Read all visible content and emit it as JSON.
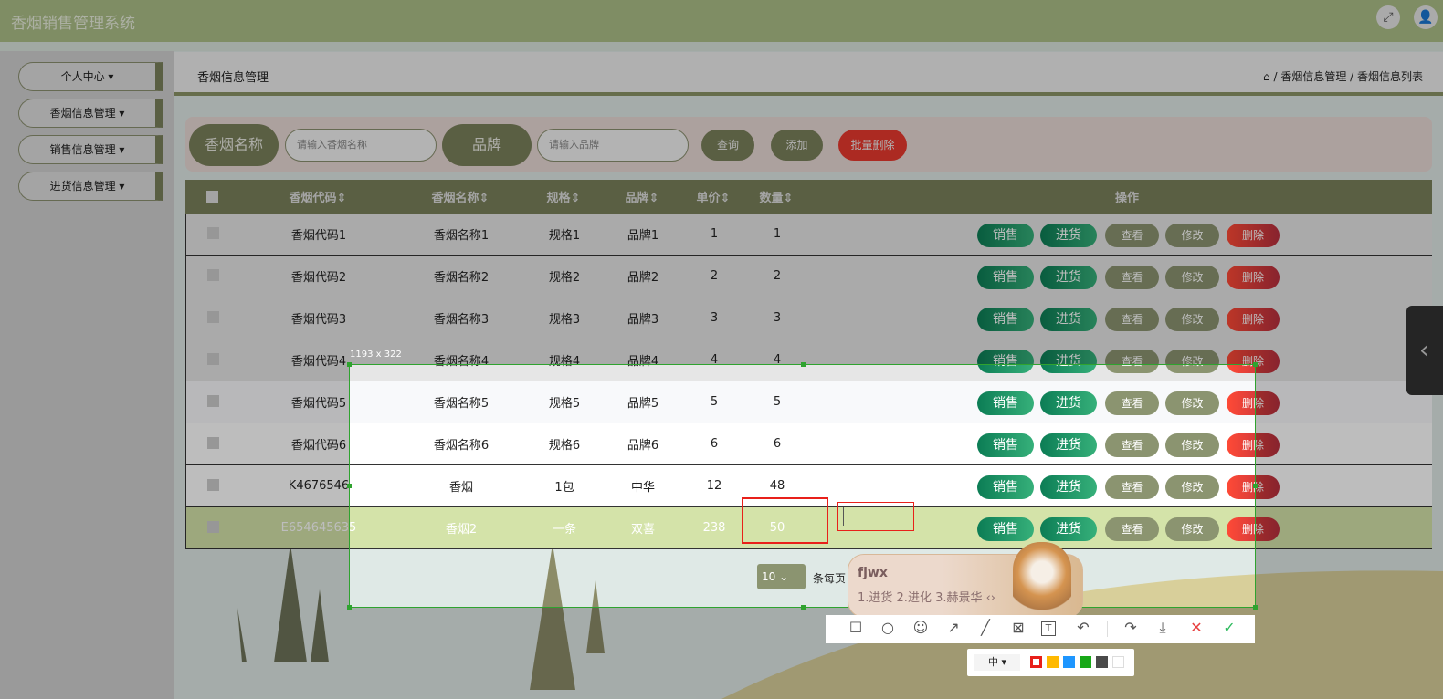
{
  "app": {
    "title": "香烟销售管理系统"
  },
  "sidebar": {
    "items": [
      {
        "label": "个人中心 ▾"
      },
      {
        "label": "香烟信息管理 ▾"
      },
      {
        "label": "销售信息管理 ▾"
      },
      {
        "label": "进货信息管理 ▾"
      }
    ]
  },
  "breadcrumb": {
    "title": "香烟信息管理",
    "path": "⌂ / 香烟信息管理 / 香烟信息列表"
  },
  "search": {
    "name_label": "香烟名称",
    "name_placeholder": "请输入香烟名称",
    "brand_label": "品牌",
    "brand_placeholder": "请输入品牌",
    "query": "查询",
    "add": "添加",
    "batch_delete": "批量删除"
  },
  "table": {
    "headers": [
      "香烟代码⇕",
      "香烟名称⇕",
      "规格⇕",
      "品牌⇕",
      "单价⇕",
      "数量⇕",
      "操作"
    ],
    "actions": [
      "销售",
      "进货",
      "查看",
      "修改",
      "删除"
    ],
    "rows": [
      [
        "香烟代码1",
        "香烟名称1",
        "规格1",
        "品牌1",
        "1",
        "1"
      ],
      [
        "香烟代码2",
        "香烟名称2",
        "规格2",
        "品牌2",
        "2",
        "2"
      ],
      [
        "香烟代码3",
        "香烟名称3",
        "规格3",
        "品牌3",
        "3",
        "3"
      ],
      [
        "香烟代码4",
        "香烟名称4",
        "规格4",
        "品牌4",
        "4",
        "4"
      ],
      [
        "香烟代码5",
        "香烟名称5",
        "规格5",
        "品牌5",
        "5",
        "5"
      ],
      [
        "香烟代码6",
        "香烟名称6",
        "规格6",
        "品牌6",
        "6",
        "6"
      ],
      [
        "K4676546",
        "香烟",
        "1包",
        "中华",
        "12",
        "48"
      ],
      [
        "E654645635",
        "香烟2",
        "一条",
        "双喜",
        "238",
        "50"
      ]
    ],
    "selected_row": 7
  },
  "pager": {
    "page_size": "10 ⌄",
    "per_page_label": "条每页"
  },
  "capture": {
    "size_label": "1193 x 322",
    "ime_input": "fjwx",
    "ime_candidates": "1.进货  2.进化  3.赫景华  ‹›",
    "font_size": "中 ▾",
    "colors": [
      "#e8201a",
      "#ffb900",
      "#1e96ff",
      "#18a818",
      "#4a4a4a",
      "#ffffff"
    ],
    "tools": [
      "rectangle-icon",
      "ellipse-icon",
      "emoji-icon",
      "arrow-icon",
      "line-icon",
      "mosaic-icon",
      "text-icon",
      "undo-icon",
      "share-icon",
      "download-icon",
      "cancel-icon",
      "confirm-icon"
    ]
  }
}
